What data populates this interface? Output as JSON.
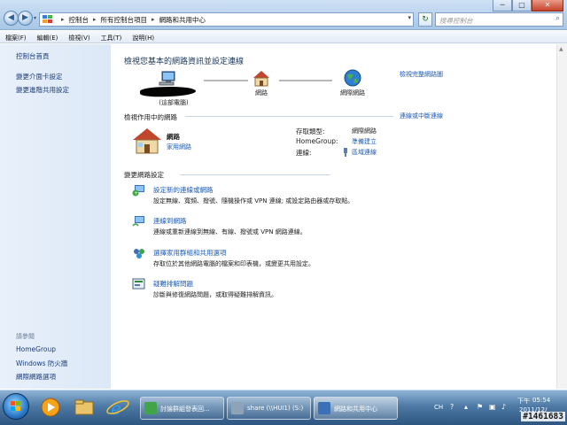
{
  "address_bar": {
    "crumbs": [
      "控制台",
      "所有控制台項目",
      "網路和共用中心"
    ]
  },
  "search": {
    "placeholder": "搜尋控制台"
  },
  "window_controls": {
    "minimize": "─",
    "maximize": "□",
    "close": "✕"
  },
  "menu": [
    "檔案(F)",
    "編輯(E)",
    "檢視(V)",
    "工具(T)",
    "說明(H)"
  ],
  "sidebar": {
    "links": [
      "控制台首頁",
      "變更介面卡設定",
      "變更進階共用設定"
    ],
    "see_also_label": "請參閱",
    "see_also": [
      "HomeGroup",
      "Windows 防火牆",
      "網際網路選項"
    ]
  },
  "main": {
    "title": "檢視您基本的網路資訊並設定連線",
    "full_map_link": "檢視完整網路圖",
    "map": {
      "computer_label": "(這部電腦)",
      "network_label": "網路",
      "internet_label": "網際網路"
    },
    "active_networks_heading": "檢視作用中的網路",
    "connect_disconnect_link": "連線或中斷連線",
    "active_network": {
      "name": "網路",
      "type_link": "家用網路",
      "props": [
        {
          "label": "存取類型:",
          "value": "網際網路",
          "is_link": false
        },
        {
          "label": "HomeGroup:",
          "value": "準備建立",
          "is_link": true
        },
        {
          "label": "連線:",
          "value": "區域連線",
          "is_link": true
        }
      ]
    },
    "change_settings_heading": "變更網路設定",
    "tasks": [
      {
        "title": "設定新的連線或網路",
        "desc": "設定無線、寬頻、撥號、隨機操作或 VPN 連線; 或設定路由器或存取點。",
        "icon": "new-connection-icon"
      },
      {
        "title": "連線到網路",
        "desc": "連線或重新連線到無線、有線、撥號或 VPN 網路連線。",
        "icon": "connect-network-icon"
      },
      {
        "title": "選擇家用群組和共用選項",
        "desc": "存取位於其他網路電腦的檔案和印表機，或變更共用設定。",
        "icon": "homegroup-icon"
      },
      {
        "title": "疑難排解問題",
        "desc": "診斷與修復網路問題，或取得疑難排解資訊。",
        "icon": "troubleshoot-icon"
      }
    ]
  },
  "taskbar": {
    "tasks": [
      {
        "label": "討論群組發表回...",
        "icon": "forum-icon"
      },
      {
        "label": "share (\\\\HUI1) (S:)",
        "icon": "drive-icon"
      },
      {
        "label": "網路和共用中心",
        "icon": "network-center-icon"
      }
    ],
    "tray": {
      "ime": "CH",
      "period": "下午",
      "time": "05:54",
      "date": "2011/12/"
    }
  },
  "watermark": "#1461683",
  "colors": {
    "link": "#1c5bb5",
    "heading": "#1e395b",
    "sidebar_bg": "#dce8f7",
    "taskbar": "#2d5580"
  }
}
